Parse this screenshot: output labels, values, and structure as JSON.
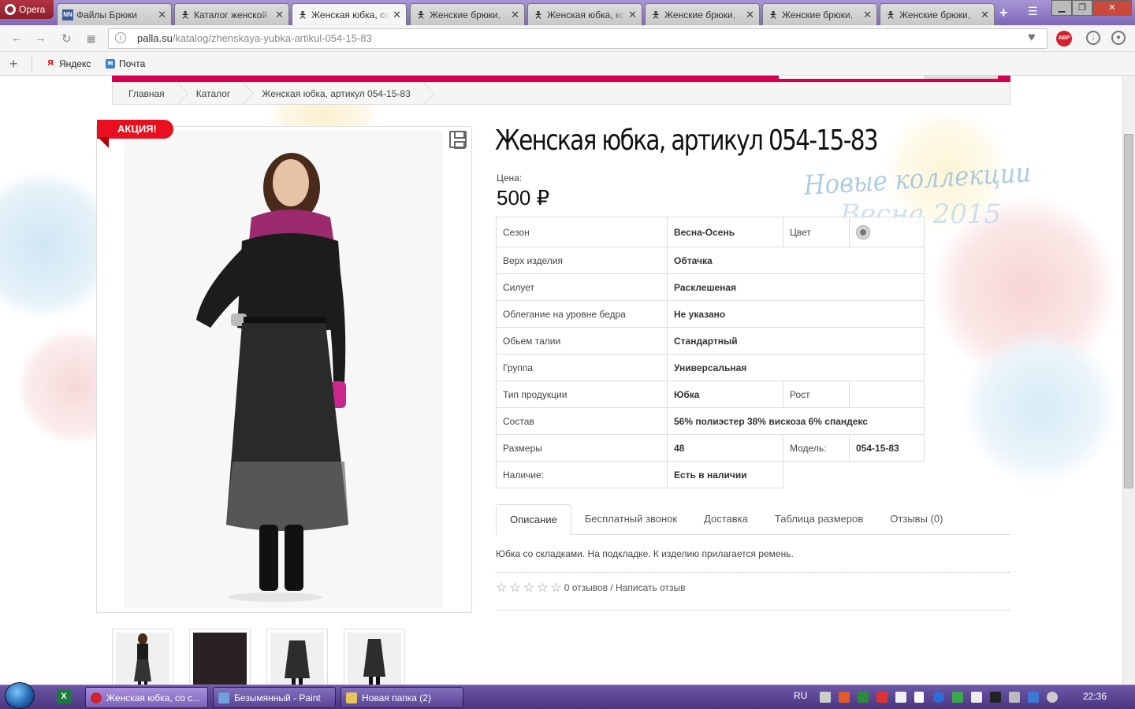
{
  "browser": {
    "app_name": "Opera",
    "tabs": [
      {
        "title": "Файлы Брюки",
        "icon": "nn-favicon"
      },
      {
        "title": "Каталог женской",
        "icon": "figures-favicon"
      },
      {
        "title": "Женская юбка, со",
        "icon": "figures-favicon",
        "active": true
      },
      {
        "title": "Женские брюки,",
        "icon": "figures-favicon"
      },
      {
        "title": "Женская юбка, ко",
        "icon": "figures-favicon"
      },
      {
        "title": "Женские брюки,",
        "icon": "figures-favicon"
      },
      {
        "title": "Женские брюки,",
        "icon": "figures-favicon"
      },
      {
        "title": "Женские брюки,",
        "icon": "figures-favicon"
      }
    ],
    "url_domain": "palla.su",
    "url_path": "/katalog/zhenskaya-yubka-artikul-054-15-83",
    "adblock_label": "ABP",
    "bookmarks": [
      {
        "label": "Яндекс",
        "icon": "yandex-icon"
      },
      {
        "label": "Почта",
        "icon": "mail-icon"
      }
    ]
  },
  "page": {
    "breadcrumbs": [
      "Главная",
      "Каталог",
      "Женская юбка, артикул 054-15-83"
    ],
    "promo_badge": "АКЦИЯ!",
    "title": "Женская юбка, артикул 054-15-83",
    "price_label": "Цена:",
    "price": "500 ₽",
    "background_text_1": "Новые коллекции",
    "background_text_2": "Весна 2015",
    "specs": [
      {
        "key": "Сезон",
        "value": "Весна-Осень",
        "key2": "Цвет",
        "value2": "color-swatch-grey"
      },
      {
        "key": "Верх изделия",
        "value": "Обтачка"
      },
      {
        "key": "Силует",
        "value": "Расклешеная"
      },
      {
        "key": "Облегание на уровне бедра",
        "value": "Не указано"
      },
      {
        "key": "Обьем талии",
        "value": "Стандартный"
      },
      {
        "key": "Группа",
        "value": "Универсальная"
      },
      {
        "key": "Тип продукции",
        "value": "Юбка",
        "key2": "Рост",
        "value2": ""
      },
      {
        "key": "Состав",
        "value": "56% полиэстер 38% вискоза 6% спандекс"
      },
      {
        "key": "Размеры",
        "value": "48",
        "key2": "Модель:",
        "value2": "054-15-83"
      },
      {
        "key": "Наличие:",
        "value": "Есть в наличии"
      }
    ],
    "tabs": [
      "Описание",
      "Бесплатный звонок",
      "Доставка",
      "Таблица размеров",
      "Отзывы (0)"
    ],
    "description": "Юбка со складками. На подкладке. К изделию прилагается ремень.",
    "rating_stars": 0,
    "reviews_text": "0 отзывов / Написать отзыв",
    "thumbnails": 4
  },
  "taskbar": {
    "items": [
      {
        "label": "Женская юбка, со с...",
        "icon": "opera-icon",
        "active": true
      },
      {
        "label": "Безымянный - Paint",
        "icon": "paint-icon"
      },
      {
        "label": "Новая папка (2)",
        "icon": "folder-icon"
      }
    ],
    "language": "RU",
    "clock": "22:36"
  },
  "colors": {
    "brand_red": "#d2004e",
    "promo_red": "#e8101e",
    "taskbar": "#5a4496",
    "tabstrip": "#8f7cc4"
  }
}
